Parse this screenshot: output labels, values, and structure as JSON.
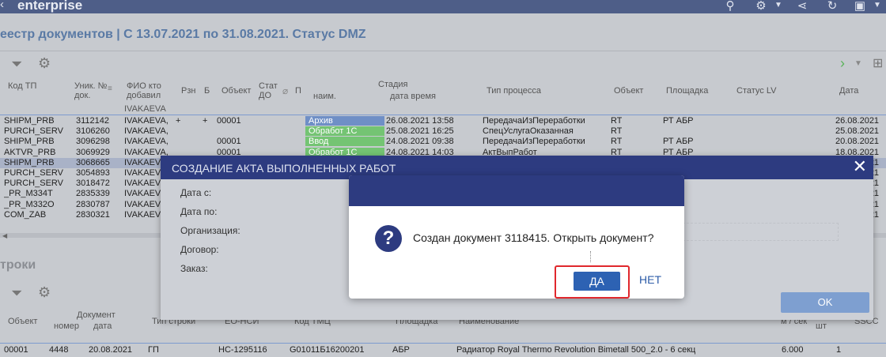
{
  "topbar": {
    "brand": "enterprise",
    "icons": [
      "search-icon",
      "gear-icon",
      "share-icon",
      "refresh-icon",
      "package-icon"
    ]
  },
  "app": {
    "title": "еестр документов | С 13.07.2021 по 31.08.2021. Статус DMZ",
    "columns": {
      "code": "Код ТП",
      "uid": "Уник. № док.",
      "fio": "ФИО кто добавил",
      "rzn": "Рзн",
      "b": "Б",
      "object": "Объект",
      "stat": "Стат ДО",
      "p": "П",
      "stage": "Стадия",
      "stage_name": "наим.",
      "stage_dt": "дата время",
      "process": "Тип процесса",
      "object2": "Объект",
      "site": "Площадка",
      "lv": "Статус LV",
      "date": "Дата"
    },
    "filter_value": "IVAKAEVA",
    "rows": [
      {
        "code": "SHIPM_PRB",
        "uid": "3112142",
        "fio": "IVAKAEVA,",
        "rzn": "+",
        "b": "+",
        "obj": "00001",
        "stage": "Архив",
        "stage_color": "blue",
        "dt": "26.08.2021 13:58",
        "proc": "ПередачаИзПереработки",
        "obj2": "RT",
        "site": "РТ АБР",
        "date": "26.08.2021"
      },
      {
        "code": "PURCH_SERV",
        "uid": "3106260",
        "fio": "IVAKAEVA,",
        "rzn": "",
        "b": "",
        "obj": "",
        "stage": "Обработ 1С",
        "stage_color": "green",
        "dt": "25.08.2021 16:25",
        "proc": "СпецУслугаОказанная",
        "obj2": "RT",
        "site": "",
        "date": "25.08.2021"
      },
      {
        "code": "SHIPM_PRB",
        "uid": "3096298",
        "fio": "IVAKAEVA,",
        "rzn": "",
        "b": "",
        "obj": "00001",
        "stage": "Ввод",
        "stage_color": "green",
        "dt": "24.08.2021 09:38",
        "proc": "ПередачаИзПереработки",
        "obj2": "RT",
        "site": "РТ АБР",
        "date": "20.08.2021"
      },
      {
        "code": "AKTVR_PRB",
        "uid": "3069929",
        "fio": "IVAKAEVA,",
        "rzn": "",
        "b": "",
        "obj": "00001",
        "stage": "Обработ 1С",
        "stage_color": "green",
        "dt": "24.08.2021 14:03",
        "proc": "АктВыпРабот",
        "obj2": "RT",
        "site": "РТ АБР",
        "date": "18.08.2021"
      },
      {
        "code": "SHIPM_PRB",
        "uid": "3068665",
        "fio": "IVAKAEV",
        "rzn": "",
        "b": "",
        "obj": "",
        "stage": "",
        "stage_color": "",
        "dt": "",
        "proc": "",
        "obj2": "",
        "site": "",
        "date": "18.08.2021"
      },
      {
        "code": "PURCH_SERV",
        "uid": "3054893",
        "fio": "IVAKAEV",
        "rzn": "",
        "b": "",
        "obj": "",
        "stage": "",
        "stage_color": "",
        "dt": "",
        "proc": "",
        "obj2": "",
        "site": "",
        "date": "17.08.2021"
      },
      {
        "code": "PURCH_SERV",
        "uid": "3018472",
        "fio": "IVAKAEV",
        "rzn": "",
        "b": "",
        "obj": "",
        "stage": "",
        "stage_color": "",
        "dt": "",
        "proc": "",
        "obj2": "",
        "site": "",
        "date": "13.08.2021"
      },
      {
        "code": "_PR_M334T",
        "uid": "2835339",
        "fio": "IVAKAEV",
        "rzn": "",
        "b": "",
        "obj": "",
        "stage": "",
        "stage_color": "",
        "dt": "",
        "proc": "",
        "obj2": "",
        "site": "",
        "date": "03.08.2021"
      },
      {
        "code": "_PR_M332O",
        "uid": "2830787",
        "fio": "IVAKAEV",
        "rzn": "",
        "b": "",
        "obj": "",
        "stage": "",
        "stage_color": "",
        "dt": "",
        "proc": "",
        "obj2": "",
        "site": "",
        "date": "03.08.2021"
      },
      {
        "code": "COM_ZAB",
        "uid": "2830321",
        "fio": "IVAKAEV",
        "rzn": "",
        "b": "",
        "obj": "",
        "stage": "",
        "stage_color": "",
        "dt": "",
        "proc": "",
        "obj2": "",
        "site": "",
        "date": "03.08.2021"
      }
    ],
    "lines_title": "троки",
    "lines_columns": {
      "object": "Объект",
      "doc": "Документ",
      "doc_num": "номер",
      "doc_date": "дата",
      "line_type": "Тип строки",
      "ed_nsi": "ЕО-НСИ",
      "tmc": "Код ТМЦ",
      "site": "Площадка",
      "name": "Наименование",
      "m_sek": "м / сек",
      "sht": "шт",
      "sscc": "SSCC"
    },
    "lines_row": {
      "object": "00001",
      "num": "4448",
      "date": "20.08.2021",
      "type": "ГП",
      "ed": "НС-1295116",
      "tmc": "G01011Б16200201",
      "site": "АБР",
      "name": "Радиатор Royal Thermo Revolution Bimetall 500_2.0 - 6 секц",
      "qty": "6.000",
      "sht": "1"
    }
  },
  "dialog": {
    "title": "СОЗДАНИЕ АКТА ВЫПОЛНЕННЫХ РАБОТ",
    "fields": [
      "Дата с:",
      "Дата по:",
      "Организация:",
      "Договор:",
      "Заказ:"
    ],
    "ok_label": "OK"
  },
  "confirm": {
    "message": "Создан документ 3118415. Открыть документ?",
    "icon": "?",
    "yes_label": "ДА",
    "no_label": "НЕТ"
  }
}
